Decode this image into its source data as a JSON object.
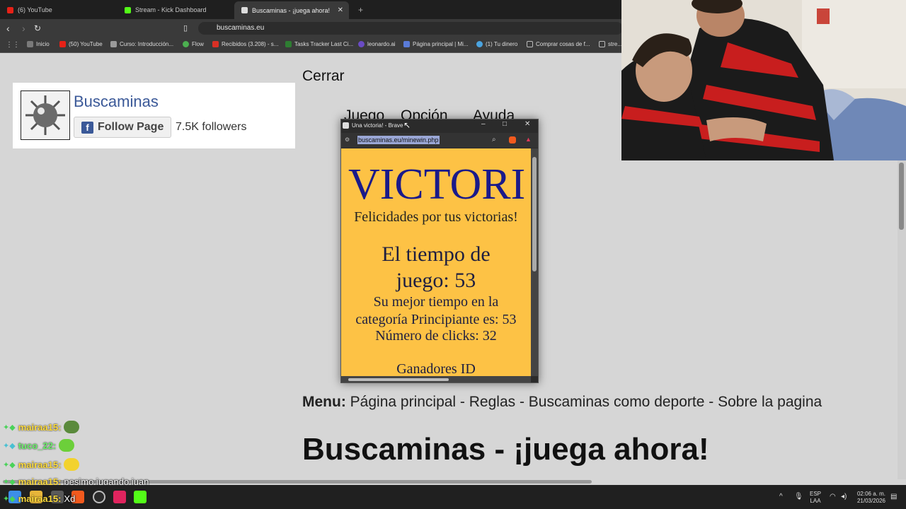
{
  "browser": {
    "tabs": [
      {
        "label": "(6) YouTube",
        "icon": "youtube-icon"
      },
      {
        "label": "Stream - Kick Dashboard",
        "icon": "kick-icon"
      },
      {
        "label": "Buscaminas - ¡juega ahora!",
        "icon": "buscaminas-icon",
        "active": true
      }
    ],
    "url": "buscaminas.eu",
    "bookmarks": [
      {
        "label": "Inicio",
        "color": "#7a7a7a"
      },
      {
        "label": "(50) YouTube",
        "color": "#e62117"
      },
      {
        "label": "Curso: Introducción...",
        "color": "#9a9a9a"
      },
      {
        "label": "Flow",
        "color": "#4caf50"
      },
      {
        "label": "Recibidos (3.208) - s...",
        "color": "#d93025"
      },
      {
        "label": "Tasks Tracker Last Ci...",
        "color": "#2e7d32"
      },
      {
        "label": "leonardo.ai",
        "color": "#6a4bc4"
      },
      {
        "label": "Página principal | Mi...",
        "color": "#5a7bd8"
      },
      {
        "label": "(1) Tu dinero",
        "color": "#4aa3df"
      },
      {
        "label": "Comprar cosas de f...",
        "color": "#bbbbbb"
      },
      {
        "label": "stre...",
        "color": "#bbbbbb"
      }
    ]
  },
  "facebook_widget": {
    "page_name": "Buscaminas",
    "follow_label": "Follow Page",
    "followers": "7.5K followers"
  },
  "page": {
    "close_label": "Cerrar",
    "menu_items": [
      "Juego",
      "Opción",
      "Ayuda"
    ],
    "menu_prefix": "Menu:",
    "menu_links": "Página principal - Reglas - Buscaminas como deporte - Sobre la pagina",
    "title": "Buscaminas - ¡juega ahora!"
  },
  "popup": {
    "window_title": "Una victoria! - Brave",
    "url": "buscaminas.eu/minewin.php",
    "victory": "VICTORI",
    "congrats": "Felicidades por tus victorias!",
    "time_line1": "El tiempo de",
    "time_line2": "juego: 53",
    "best_line1": "Su mejor tiempo en la",
    "best_line2": "categoría Principiante es: 53",
    "clicks": "Número de clicks: 32",
    "winners": "Ganadores ID"
  },
  "chat": [
    {
      "user": "mairaa15:",
      "msg": "",
      "emote_color": "#5a8a3c"
    },
    {
      "user": "tuco_22:",
      "msg": "",
      "emote_color": "#6ccf3a"
    },
    {
      "user": "mairaa15:",
      "msg": "",
      "emote_color": "#f2d22e"
    },
    {
      "user": "mairaa15:",
      "msg": "pesimo jugando juan",
      "emote_color": ""
    },
    {
      "user": "mairaa15:",
      "msg": "Xd",
      "emote_color": ""
    }
  ],
  "taskbar": {
    "lang_top": "ESP",
    "lang_bottom": "LAA",
    "time": "02:06 a. m.",
    "date": "21/03/2026"
  }
}
